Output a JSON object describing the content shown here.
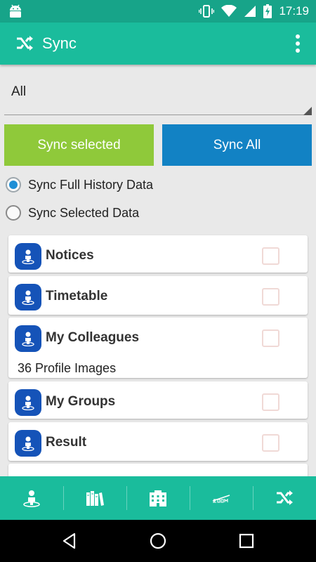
{
  "status_bar": {
    "time": "17:19",
    "icons": [
      "android-debug-icon",
      "vibrate-icon",
      "wifi-icon",
      "signal-icon",
      "battery-charging-icon"
    ]
  },
  "app_bar": {
    "title": "Sync",
    "icons": [
      "shuffle-icon",
      "overflow-menu-icon"
    ]
  },
  "filter": {
    "selected": "All"
  },
  "actions": {
    "sync_selected": "Sync selected",
    "sync_all": "Sync All"
  },
  "sync_mode": {
    "options": [
      {
        "label": "Sync Full History Data",
        "checked": true
      },
      {
        "label": "Sync Selected Data",
        "checked": false
      }
    ]
  },
  "items": [
    {
      "name": "Notices",
      "detail": "",
      "checked": false
    },
    {
      "name": "Timetable",
      "detail": "",
      "checked": false
    },
    {
      "name": "My Colleagues",
      "detail": "36 Profile Images",
      "checked": false
    },
    {
      "name": "My Groups",
      "detail": "",
      "checked": false
    },
    {
      "name": "Result",
      "detail": "",
      "checked": false
    }
  ],
  "bottom_nav": {
    "tabs": [
      "person-pin-icon",
      "library-icon",
      "building-icon",
      "zoom-icon",
      "shuffle-icon"
    ],
    "active": 4
  },
  "colors": {
    "primary": "#1abc9c",
    "status_bar": "#17a489",
    "sync_selected": "#8fc93a",
    "sync_all": "#1282c4",
    "item_icon": "#1553b8"
  }
}
